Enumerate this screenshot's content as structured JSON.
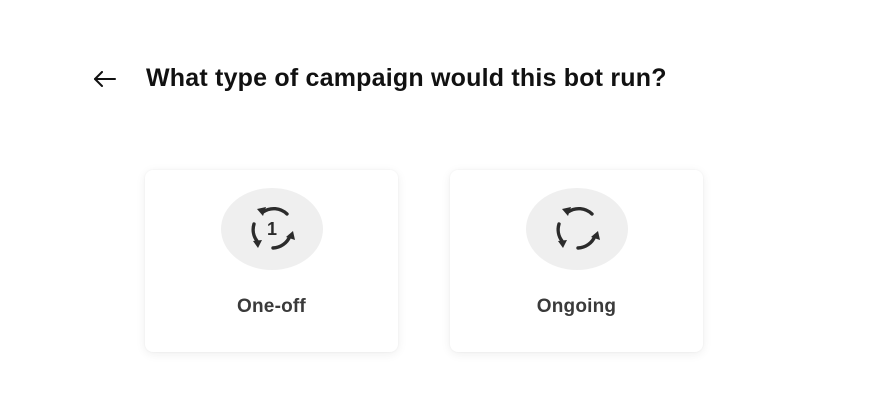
{
  "header": {
    "back_icon": "arrow-left-icon",
    "title": "What type of campaign would this bot run?"
  },
  "options": [
    {
      "label": "One-off",
      "icon": "cycle-once-icon",
      "icon_text": "1"
    },
    {
      "label": "Ongoing",
      "icon": "cycle-repeat-icon"
    }
  ],
  "colors": {
    "title": "#111111",
    "card_label": "#3a3a3a",
    "icon_bg": "#efefef",
    "icon_stroke": "#2b2b2b"
  }
}
